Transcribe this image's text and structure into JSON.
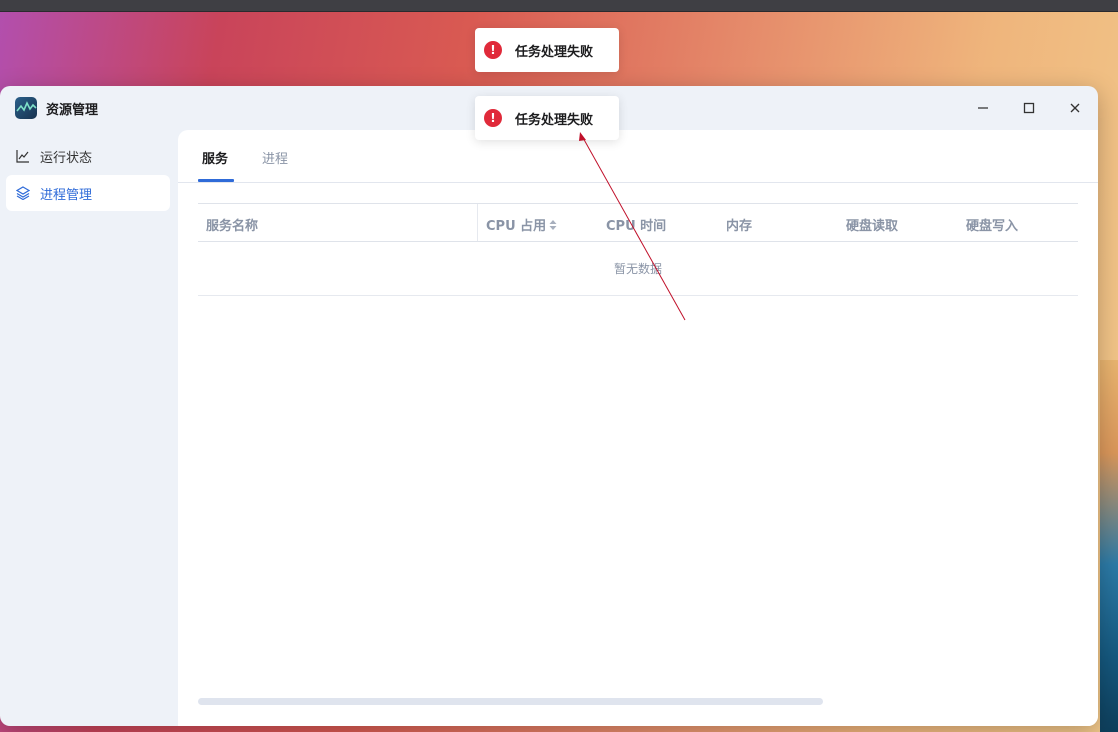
{
  "window": {
    "title": "资源管理"
  },
  "titlebar": {
    "minimize_icon": "minimize-icon",
    "maximize_icon": "maximize-icon",
    "close_icon": "close-icon"
  },
  "sidebar": {
    "items": [
      {
        "label": "运行状态",
        "icon": "line-chart-icon",
        "active": false
      },
      {
        "label": "进程管理",
        "icon": "layers-icon",
        "active": true
      }
    ]
  },
  "tabs": [
    {
      "label": "服务",
      "active": true
    },
    {
      "label": "进程",
      "active": false
    }
  ],
  "table": {
    "columns": [
      "服务名称",
      "CPU 占用",
      "CPU 时间",
      "内存",
      "硬盘读取",
      "硬盘写入"
    ],
    "sortable_column": "CPU 占用",
    "empty_text": "暂无数据"
  },
  "toasts": [
    {
      "message": "任务处理失败",
      "icon": "error-icon"
    },
    {
      "message": "任务处理失败",
      "icon": "error-icon"
    }
  ],
  "colors": {
    "accent": "#2f6bd8",
    "error": "#e02a3a",
    "annotation_arrow": "#c0102a"
  }
}
